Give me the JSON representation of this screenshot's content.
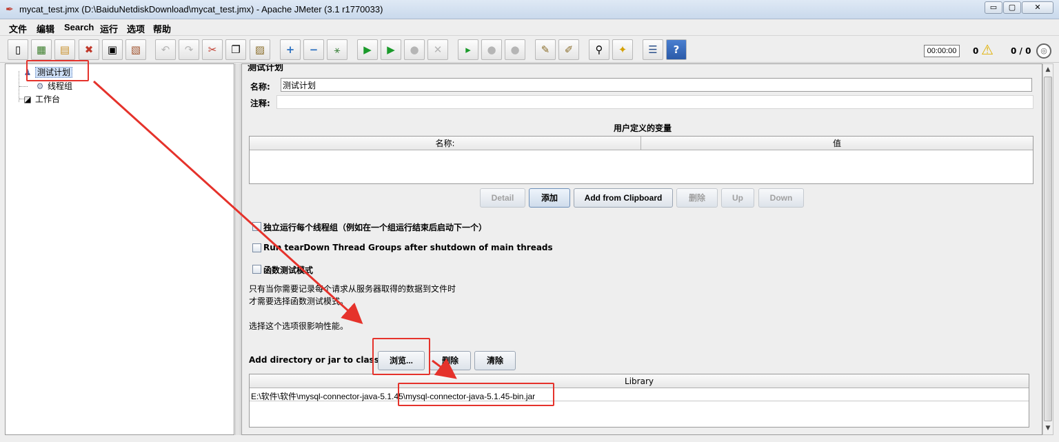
{
  "window": {
    "title": "mycat_test.jmx (D:\\BaiduNetdiskDownload\\mycat_test.jmx) - Apache JMeter (3.1 r1770033)",
    "min_glyph": "▭",
    "max_glyph": "▢",
    "close_glyph": "✕"
  },
  "menu": [
    "文件",
    "编辑",
    "Search",
    "运行",
    "选项",
    "帮助"
  ],
  "toolbar": {
    "icons": [
      {
        "name": "new-icon",
        "glyph": "▯"
      },
      {
        "name": "templates-icon",
        "glyph": "▦"
      },
      {
        "name": "open-icon",
        "glyph": "▤"
      },
      {
        "name": "close-file-icon",
        "glyph": "✖"
      },
      {
        "name": "save-icon",
        "glyph": "▣"
      },
      {
        "name": "save-as-icon",
        "glyph": "▧"
      },
      {
        "name": "undo-icon",
        "glyph": "↶"
      },
      {
        "name": "redo-icon",
        "glyph": "↷"
      },
      {
        "name": "cut-icon",
        "glyph": "✂"
      },
      {
        "name": "copy-icon",
        "glyph": "❐"
      },
      {
        "name": "paste-icon",
        "glyph": "▨"
      },
      {
        "name": "expand-icon",
        "glyph": "+"
      },
      {
        "name": "collapse-icon",
        "glyph": "−"
      },
      {
        "name": "toggle-icon",
        "glyph": "⚹"
      },
      {
        "name": "start-icon",
        "glyph": "▶"
      },
      {
        "name": "start-no-pause-icon",
        "glyph": "▶"
      },
      {
        "name": "stop-icon",
        "glyph": "●"
      },
      {
        "name": "shutdown-icon",
        "glyph": "✕"
      },
      {
        "name": "remote-start-icon",
        "glyph": "▸"
      },
      {
        "name": "remote-stop-icon",
        "glyph": "●"
      },
      {
        "name": "remote-shutdown-icon",
        "glyph": "●"
      },
      {
        "name": "clear-icon",
        "glyph": "✎"
      },
      {
        "name": "clear-all-icon",
        "glyph": "✐"
      },
      {
        "name": "search-icon",
        "glyph": "⚲"
      },
      {
        "name": "reset-search-icon",
        "glyph": "✦"
      },
      {
        "name": "function-helper-icon",
        "glyph": "☰"
      },
      {
        "name": "help-icon",
        "glyph": "?"
      }
    ],
    "timer": "00:00:00",
    "error_count": "0",
    "warn_glyph": "⚠",
    "threads": "0 / 0",
    "globe_glyph": "◎"
  },
  "tree": {
    "items": [
      {
        "label": "测试计划",
        "icon": "test-plan-icon",
        "glyph": "♟"
      },
      {
        "label": "线程组",
        "icon": "thread-group-icon",
        "glyph": "⚙"
      },
      {
        "label": "工作台",
        "icon": "workbench-icon",
        "glyph": "◪"
      }
    ]
  },
  "plan": {
    "heading": "测试计划",
    "name_label": "名称:",
    "name_value": "测试计划",
    "comment_label": "注释:",
    "comment_value": "",
    "vars_title": "用户定义的变量",
    "vars_columns": [
      "名称:",
      "值"
    ],
    "buttons": {
      "detail": "Detail",
      "add": "添加",
      "add_clipboard": "Add from Clipboard",
      "delete": "删除",
      "up": "Up",
      "down": "Down"
    },
    "options": [
      "独立运行每个线程组（例如在一个组运行结束后启动下一个）",
      "Run tearDown Thread Groups after shutdown of main threads",
      "函数测试模式"
    ],
    "note_lines": [
      "只有当你需要记录每个请求从服务器取得的数据到文件时",
      "才需要选择函数测试模式。",
      "选择这个选项很影响性能。"
    ],
    "classpath_label": "Add directory or jar to classpath",
    "classpath_buttons": {
      "browse": "浏览...",
      "delete": "删除",
      "clear": "清除"
    },
    "library_header": "Library",
    "library_rows": [
      "E:\\软件\\软件\\mysql-connector-java-5.1.45\\mysql-connector-java-5.1.45-bin.jar"
    ]
  },
  "colors": {
    "annotation": "#e5322b",
    "selection": "#cfe0f7"
  }
}
